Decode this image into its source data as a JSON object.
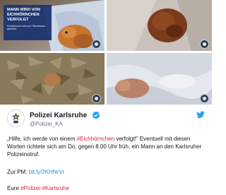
{
  "media": {
    "headline_title": "MANN WIRD VON EICHHÖRNCHEN VERFOLGT",
    "headline_sub": "Eichhörnchen wird zur Polizeiwache gebracht"
  },
  "author": {
    "display_name": "Polizei Karlsruhe",
    "handle": "@Polizei_KA",
    "verified_icon": "verified-badge-icon",
    "platform_icon": "twitter-bird-icon"
  },
  "tweet": {
    "text_before": "„Hilfe, ich werde von einem ",
    "hashtag_inline": "#Eichhörnchen",
    "text_after": " verfolgt!\" Eventuell mit diesen Worten richtete sich am Do, gegen 8.00 Uhr früh, ein Mann an den Karlsruher Polizeinotruf.",
    "pm_label": "Zur PM: ",
    "pm_link": "bit.ly/2KHNrVr",
    "closing_text": "Eure ",
    "closing_tag1": "#Polizei",
    "closing_tag2": "#Karlsruhe"
  },
  "colors": {
    "link": "#1b95e0",
    "hashtag": "#d8243a",
    "overlay": "#1c3470"
  }
}
